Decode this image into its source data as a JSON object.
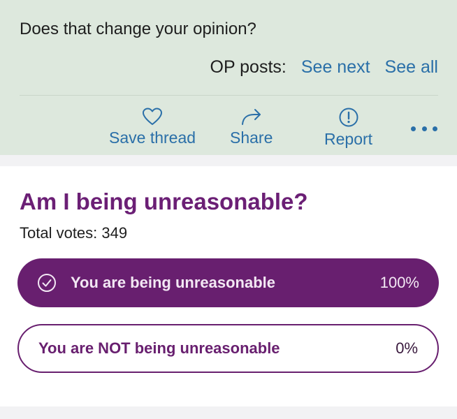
{
  "post": {
    "text": "Does that change your opinion?",
    "op_posts_label": "OP posts:",
    "see_next": "See next",
    "see_all": "See all"
  },
  "actions": {
    "save_thread": "Save thread",
    "share": "Share",
    "report": "Report"
  },
  "poll": {
    "title": "Am I being unreasonable?",
    "total_votes": "Total votes: 349",
    "options": [
      {
        "label": "You are being unreasonable",
        "percent": "100%",
        "selected": true
      },
      {
        "label": "You are NOT being unreasonable",
        "percent": "0%",
        "selected": false
      }
    ]
  },
  "colors": {
    "accent_link": "#2a6fa8",
    "poll_purple": "#681f6f",
    "footer_background": "#dde8dd"
  },
  "icons": [
    "heart-icon",
    "share-arrow-icon",
    "report-exclamation-icon",
    "more-dots-icon",
    "check-circle-icon"
  ]
}
